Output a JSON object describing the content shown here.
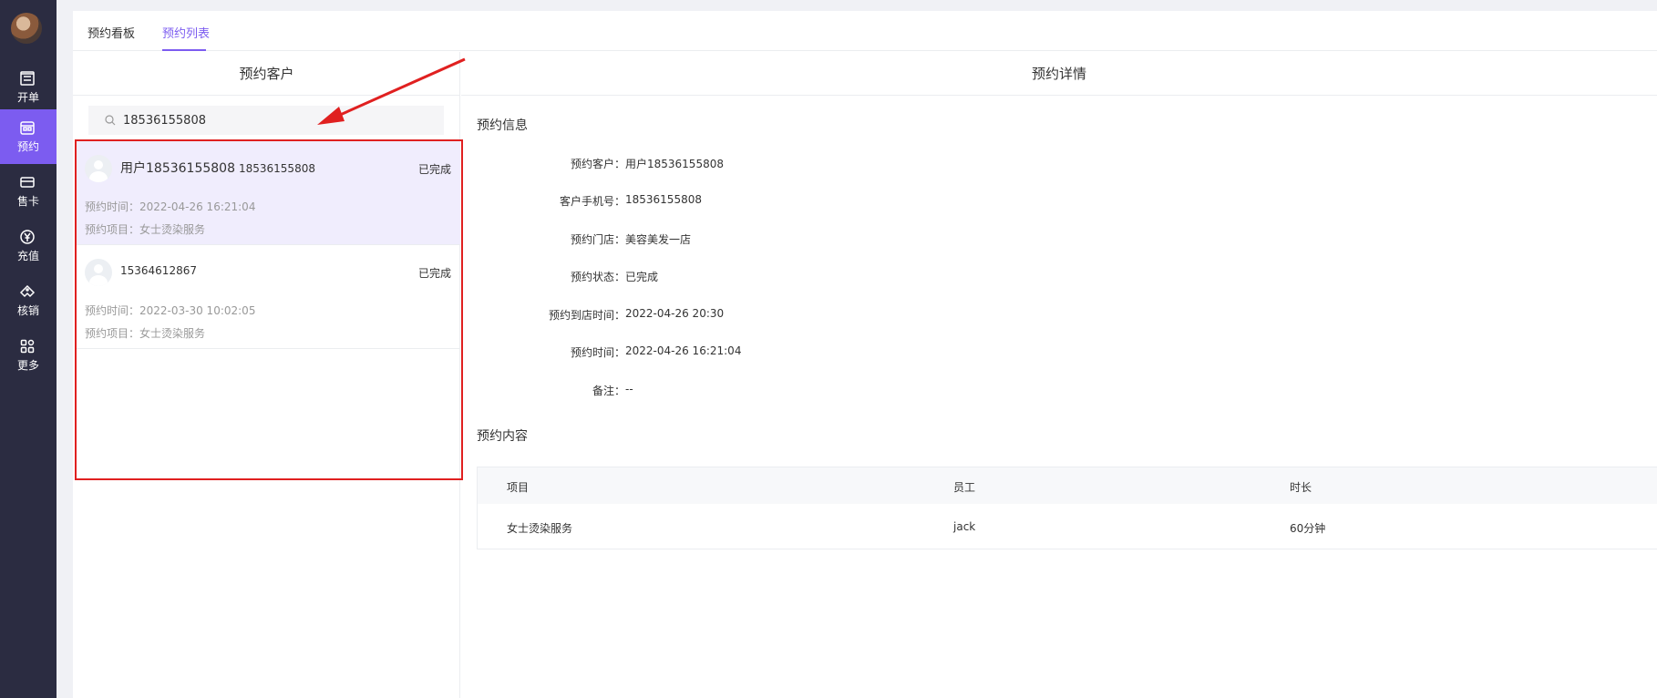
{
  "sidebar": {
    "items": [
      {
        "label": "开单",
        "icon": "receipt-icon"
      },
      {
        "label": "预约",
        "icon": "calendar-icon"
      },
      {
        "label": "售卡",
        "icon": "card-icon"
      },
      {
        "label": "充值",
        "icon": "yen-icon"
      },
      {
        "label": "核销",
        "icon": "ticket-icon"
      },
      {
        "label": "更多",
        "icon": "grid-icon"
      }
    ],
    "active_index": 1,
    "accent_color": "#7c5cf0"
  },
  "tabs": [
    {
      "label": "预约看板"
    },
    {
      "label": "预约列表"
    }
  ],
  "active_tab": 1,
  "customers": {
    "title": "预约客户",
    "search_value": "18536155808",
    "items": [
      {
        "name": "用户18536155808",
        "phone": "18536155808",
        "status": "已完成",
        "time": "预约时间：2022-04-26 16:21:04",
        "project": "预约项目：女士烫染服务"
      },
      {
        "name": "15364612867",
        "phone": "",
        "status": "已完成",
        "time": "预约时间：2022-03-30 10:02:05",
        "project": "预约项目：女士烫染服务"
      }
    ]
  },
  "detail": {
    "title": "预约详情",
    "info_title": "预约信息",
    "rows": [
      {
        "key": "预约客户：",
        "value": "用户18536155808"
      },
      {
        "key": "客户手机号：",
        "value": "18536155808"
      },
      {
        "key": "预约门店：",
        "value": "美容美发一店"
      },
      {
        "key": "预约状态：",
        "value": "已完成"
      },
      {
        "key": "预约到店时间：",
        "value": "2022-04-26 20:30"
      },
      {
        "key": "预约时间：",
        "value": "2022-04-26 16:21:04"
      },
      {
        "key": "备注：",
        "value": "--"
      }
    ],
    "content_title": "预约内容",
    "table": {
      "headers": [
        "项目",
        "员工",
        "时长"
      ],
      "rows": [
        [
          "女士烫染服务",
          "jack",
          "60分钟"
        ]
      ]
    }
  },
  "annotation_color": "#e02020"
}
